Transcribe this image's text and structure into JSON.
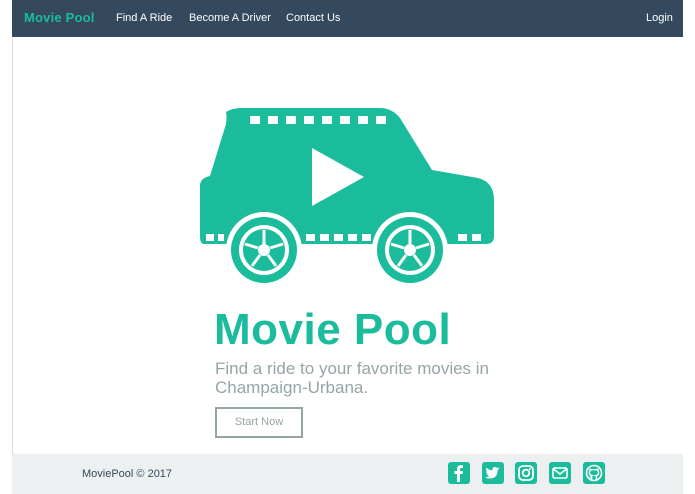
{
  "navbar": {
    "brand": "Movie Pool",
    "links": [
      "Find A Ride",
      "Become A Driver",
      "Contact Us"
    ],
    "login": "Login"
  },
  "hero": {
    "logo_icon": "movie-car-icon",
    "title": "Movie Pool",
    "subtitle": "Find a ride to your favorite movies in Champaign-Urbana.",
    "button": "Start Now"
  },
  "footer": {
    "copyright": "MoviePool © 2017",
    "social_icons": [
      "facebook-icon",
      "twitter-icon",
      "instagram-icon",
      "email-icon",
      "github-icon"
    ]
  },
  "colors": {
    "accent": "#1abc9c",
    "navbar": "#34495e",
    "muted": "#95a5a6",
    "footer": "#ecf0f1"
  }
}
